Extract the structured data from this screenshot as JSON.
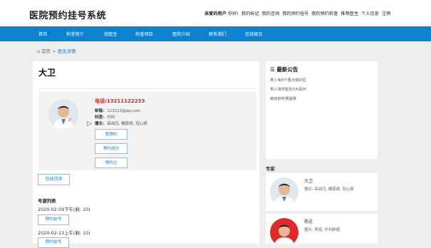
{
  "site": {
    "title": "医院预约挂号系统"
  },
  "user_bar": {
    "greeting": "亲爱的用户",
    "hello": "你好!",
    "links": [
      "我的标记",
      "我的咨询",
      "我的预约挂号",
      "我的预约检查",
      "推荐医生",
      "个人信息",
      "注销"
    ]
  },
  "nav": {
    "items": [
      "首页",
      "科室简介",
      "找医生",
      "检查项目",
      "医院介绍",
      "联系我们",
      "在线留言"
    ]
  },
  "breadcrumb": {
    "home": "首页",
    "separator": "»",
    "current": "医生详情"
  },
  "doctor": {
    "name": "大卫",
    "phone": "电话:13211122233",
    "email_label": "邮箱:",
    "email": "123123@qq.com",
    "dept_label": "科室:",
    "dept": "内科",
    "skill_label": "擅长:",
    "skill": "高血压, 糖尿病, 冠心病",
    "buttons": [
      "暂预约",
      "预约成功",
      "预约过"
    ]
  },
  "consult_button": "在线咨询",
  "schedule": {
    "title": "号源列表",
    "slots": [
      {
        "time": "2020-02-09下午(剩: 10)",
        "button": "预约挂号"
      },
      {
        "time": "2020-02-13上午(剩: 10)",
        "button": "预约挂号"
      }
    ]
  },
  "notices": {
    "title": "最新公告",
    "items": [
      "男人有8个重点保护区",
      "男人突然拒你3大损坏",
      "瘦身前吃哪首歌"
    ]
  },
  "experts": {
    "label": "专家",
    "items": [
      {
        "name": "大卫",
        "skill": "擅长:    高血压, 糖尿病, 冠心病"
      },
      {
        "name": "杨芝",
        "skill": "擅长:    胃癌, 外科肿瘤"
      }
    ]
  },
  "colors": {
    "nav": "#0d83d0",
    "phone": "#e21b1b",
    "link": "#1c7ad0"
  }
}
